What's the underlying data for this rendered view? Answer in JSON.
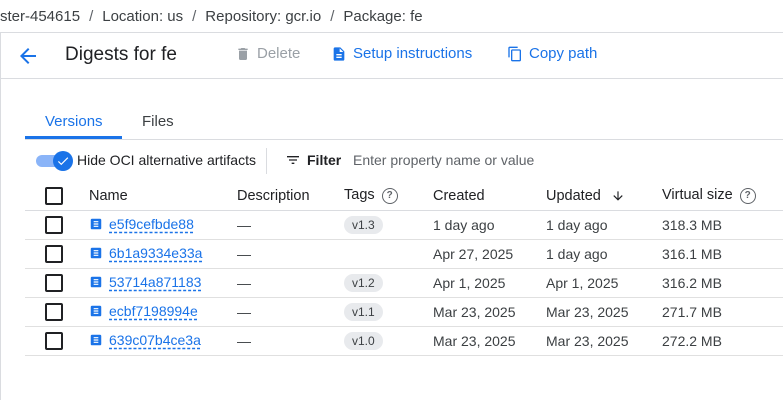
{
  "breadcrumb": {
    "items": [
      "ster-454615",
      "Location: us",
      "Repository: gcr.io",
      "Package: fe"
    ],
    "separator": "/"
  },
  "header": {
    "title": "Digests for fe",
    "delete_label": "Delete",
    "setup_label": "Setup instructions",
    "copy_label": "Copy path"
  },
  "tabs": [
    {
      "label": "Versions",
      "active": true
    },
    {
      "label": "Files",
      "active": false
    }
  ],
  "filter_bar": {
    "toggle_label": "Hide OCI alternative artifacts",
    "toggle_on": true,
    "filter_label": "Filter",
    "placeholder": "Enter property name or value"
  },
  "table": {
    "columns": [
      "Name",
      "Description",
      "Tags",
      "Created",
      "Updated",
      "Virtual size"
    ],
    "sort_column": "Updated",
    "sort_direction": "descending",
    "rows": [
      {
        "name": "e5f9cefbde88",
        "description": "—",
        "tag": "v1.3",
        "created": "1 day ago",
        "updated": "1 day ago",
        "size": "318.3 MB"
      },
      {
        "name": "6b1a9334e33a",
        "description": "—",
        "tag": "",
        "created": "Apr 27, 2025",
        "updated": "1 day ago",
        "size": "316.1 MB"
      },
      {
        "name": "53714a871183",
        "description": "—",
        "tag": "v1.2",
        "created": "Apr 1, 2025",
        "updated": "Apr 1, 2025",
        "size": "316.2 MB"
      },
      {
        "name": "ecbf7198994e",
        "description": "—",
        "tag": "v1.1",
        "created": "Mar 23, 2025",
        "updated": "Mar 23, 2025",
        "size": "271.7 MB"
      },
      {
        "name": "639c07b4ce3a",
        "description": "—",
        "tag": "v1.0",
        "created": "Mar 23, 2025",
        "updated": "Mar 23, 2025",
        "size": "272.2 MB"
      }
    ]
  },
  "colors": {
    "accent": "#1a73e8",
    "divider": "#dadce0",
    "tag_bg": "#e8eaed"
  }
}
